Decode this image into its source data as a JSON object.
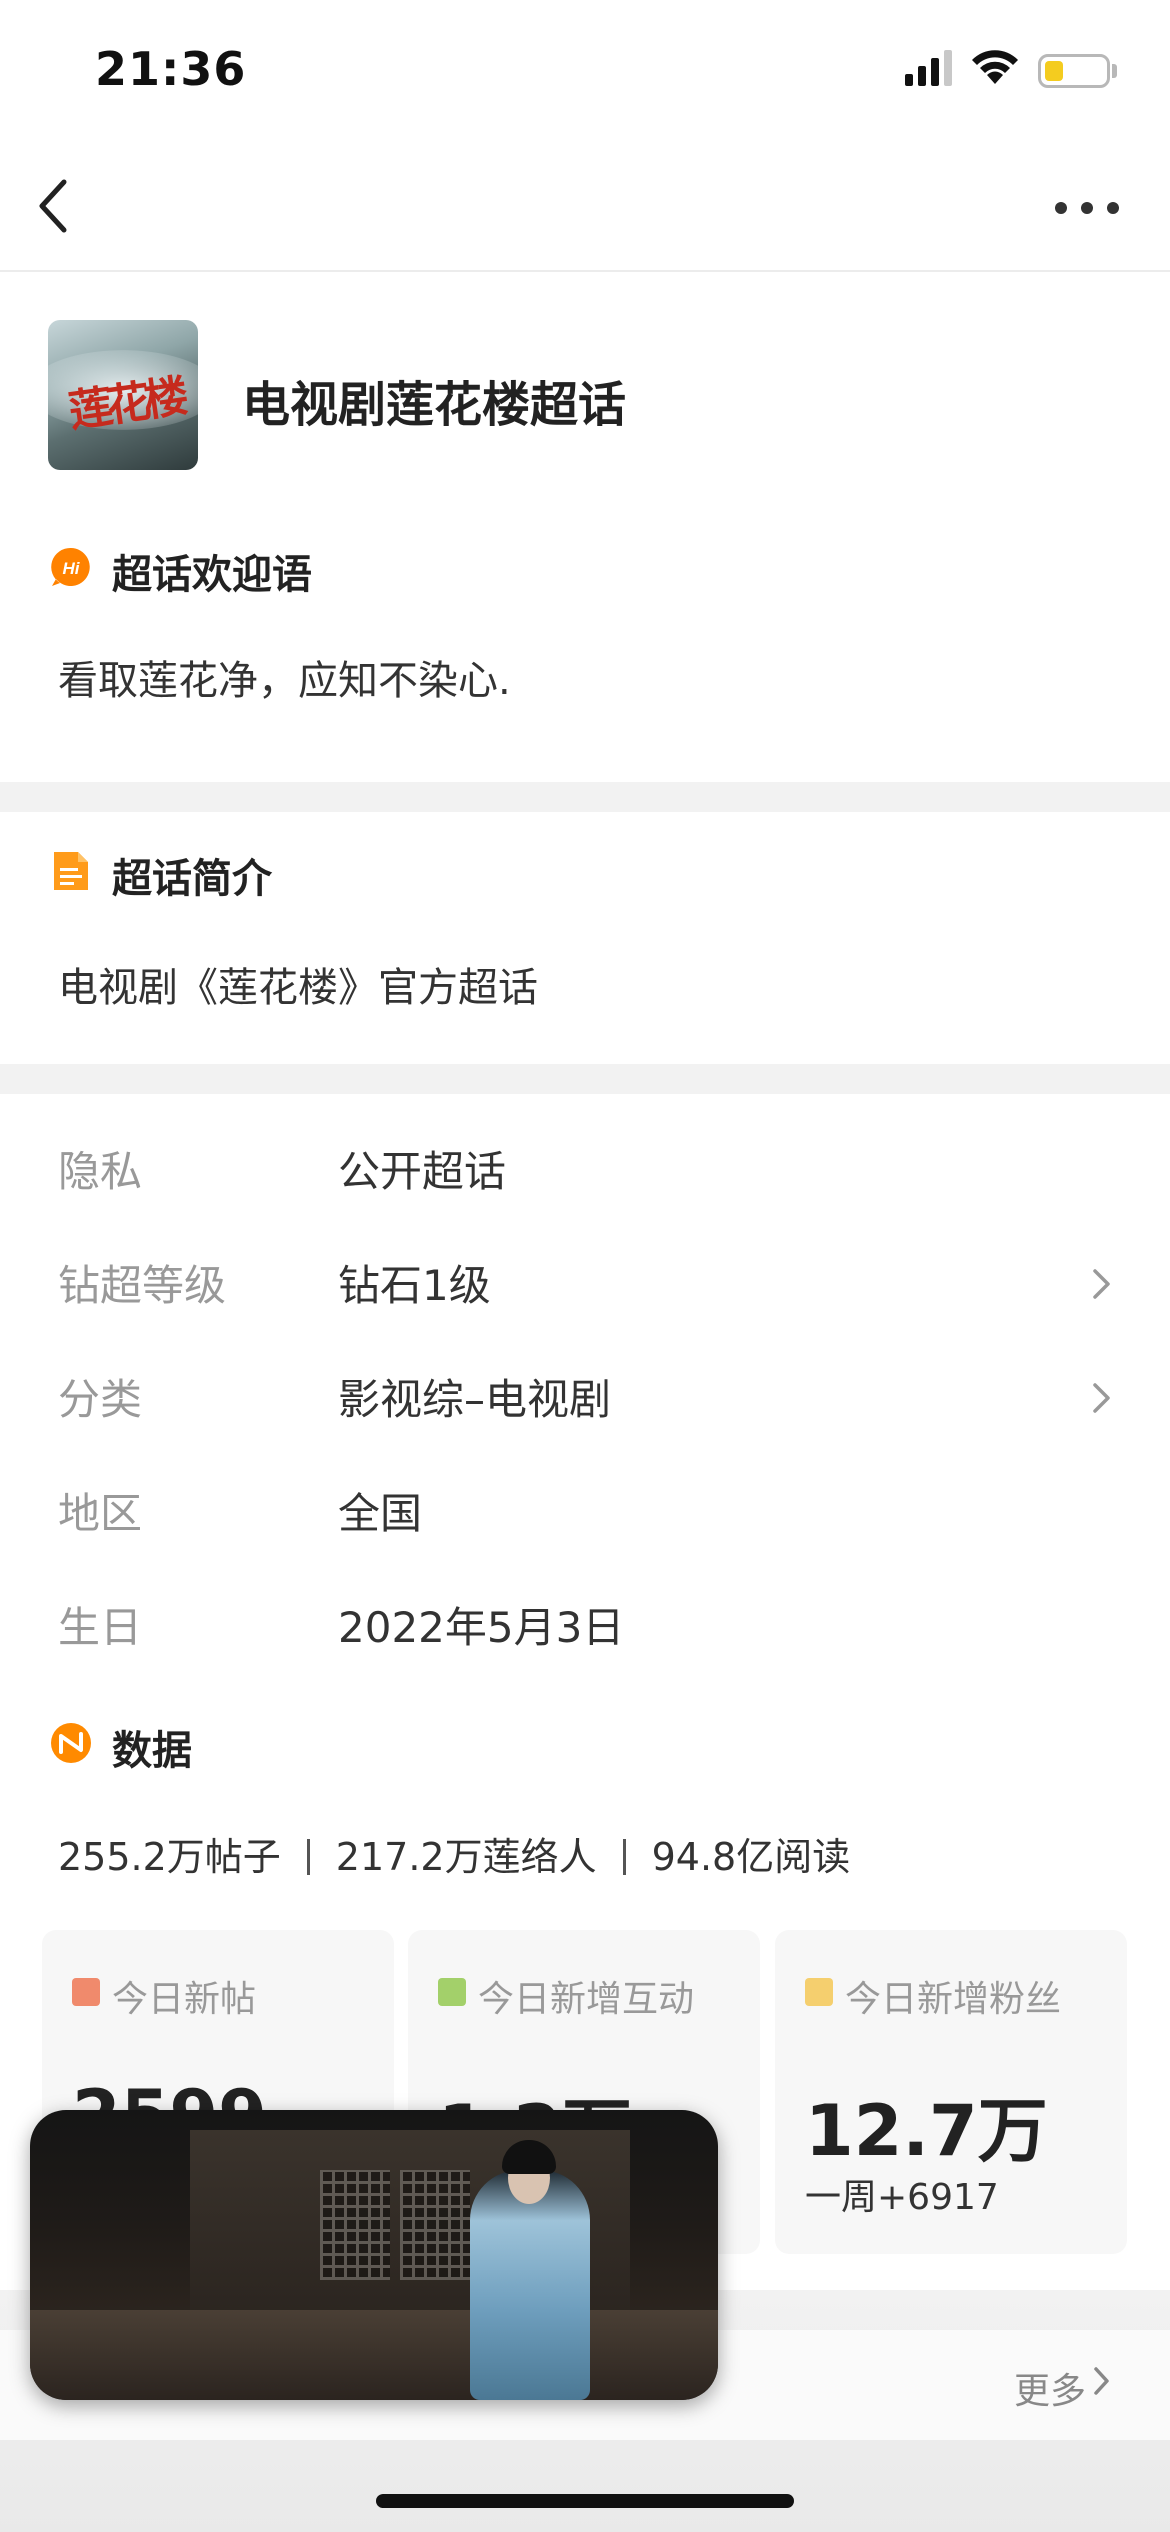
{
  "status": {
    "time": "21:36"
  },
  "header": {
    "title": "电视剧莲花楼超话",
    "cover_glyph": "莲花楼"
  },
  "welcome": {
    "icon": "hi-badge-icon",
    "icon_text": "Hi",
    "title": "超话欢迎语",
    "text": "看取莲花净，应知不染心."
  },
  "intro": {
    "icon": "document-icon",
    "title": "超话简介",
    "text": "电视剧《莲花楼》官方超话"
  },
  "info": {
    "privacy": {
      "label": "隐私",
      "value": "公开超话"
    },
    "level": {
      "label": "钻超等级",
      "value": "钻石1级"
    },
    "category": {
      "label": "分类",
      "value": "影视综–电视剧"
    },
    "region": {
      "label": "地区",
      "value": "全国"
    },
    "birthday": {
      "label": "生日",
      "value": "2022年5月3日"
    }
  },
  "data_section": {
    "icon": "data-n-icon",
    "title": "数据",
    "posts": "255.2万帖子",
    "members": "217.2万莲络人",
    "reads": "94.8亿阅读"
  },
  "cards": [
    {
      "label": "今日新帖",
      "value": "2599",
      "sub": "",
      "color": "#f08a6c"
    },
    {
      "label": "今日新增互动",
      "value": "1.2万",
      "sub": "",
      "color": "#a3d06a"
    },
    {
      "label": "今日新增粉丝",
      "value": "12.7万",
      "sub": "一周+6917",
      "color": "#f5cf6e"
    }
  ],
  "bottom": {
    "more": "更多"
  },
  "colors": {
    "accent": "#ff8200",
    "battery": "#f4cc1f"
  }
}
